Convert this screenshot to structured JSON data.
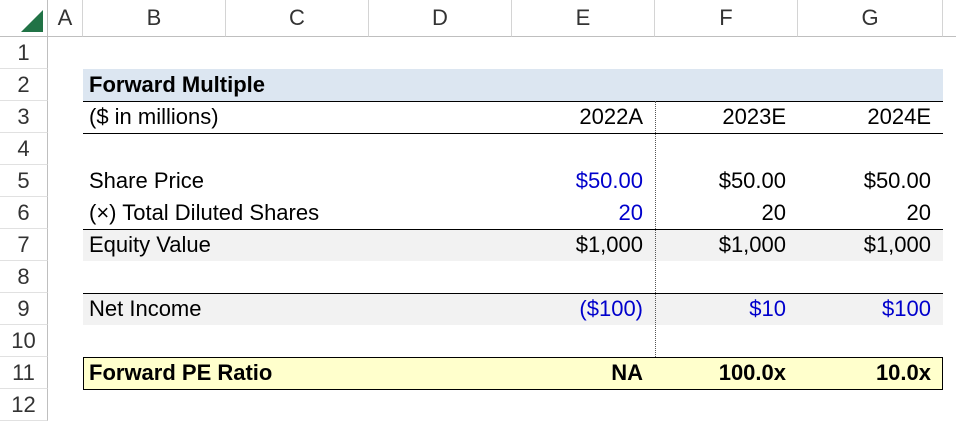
{
  "columns": [
    "A",
    "B",
    "C",
    "D",
    "E",
    "F",
    "G"
  ],
  "rows": [
    "1",
    "2",
    "3",
    "4",
    "5",
    "6",
    "7",
    "8",
    "9",
    "10",
    "11",
    "12"
  ],
  "table": {
    "title": "Forward Multiple",
    "units": "($ in millions)",
    "years": [
      "2022A",
      "2023E",
      "2024E"
    ],
    "share_price": {
      "label": "Share Price",
      "values": [
        "$50.00",
        "$50.00",
        "$50.00"
      ]
    },
    "diluted_shares": {
      "label": "(×) Total Diluted Shares",
      "values": [
        "20",
        "20",
        "20"
      ]
    },
    "equity_value": {
      "label": "Equity Value",
      "values": [
        "$1,000",
        "$1,000",
        "$1,000"
      ]
    },
    "net_income": {
      "label": "Net Income",
      "values": [
        "($100)",
        "$10",
        "$100"
      ]
    },
    "forward_pe": {
      "label": "Forward PE Ratio",
      "values": [
        "NA",
        "100.0x",
        "10.0x"
      ]
    }
  },
  "colors": {
    "input_blue": "#0000cc",
    "title_band": "#dce6f1",
    "highlight_yellow": "#ffffcc",
    "excel_green": "#217346"
  }
}
